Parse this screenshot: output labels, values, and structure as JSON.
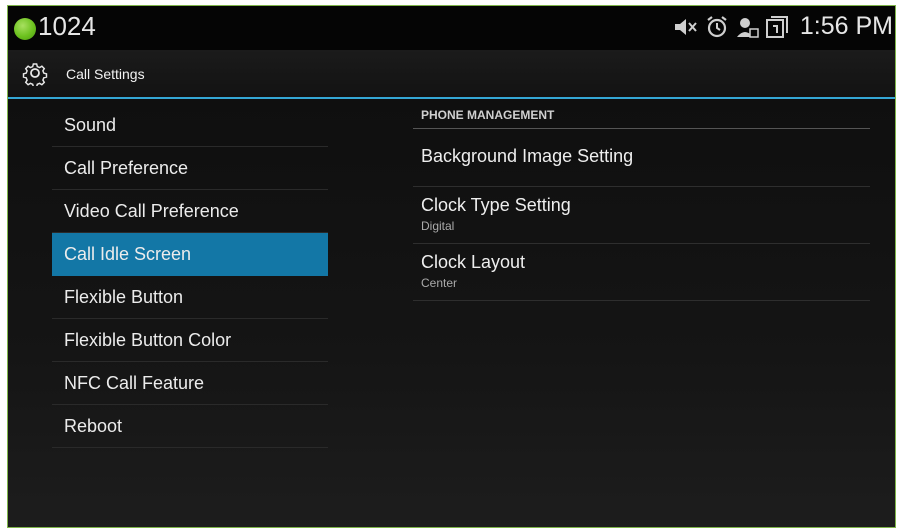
{
  "statusbar": {
    "extension": "1024",
    "time": "1:56 PM",
    "icons": [
      "speaker-muted-icon",
      "alarm-icon",
      "account-icon",
      "screen-icon"
    ],
    "colors": {
      "presence": "#6cc11e"
    }
  },
  "titlebar": {
    "icon": "gear-icon",
    "title": "Call Settings",
    "colors": {
      "divider": "#34a6d4"
    }
  },
  "menu": {
    "selected_index": 3,
    "colors": {
      "selected": "#1377a6"
    },
    "items": [
      {
        "label": "Sound"
      },
      {
        "label": "Call Preference"
      },
      {
        "label": "Video Call Preference"
      },
      {
        "label": "Call Idle Screen"
      },
      {
        "label": "Flexible Button"
      },
      {
        "label": "Flexible Button Color"
      },
      {
        "label": "NFC Call Feature"
      },
      {
        "label": "Reboot"
      }
    ]
  },
  "panel": {
    "section_header": "PHONE MANAGEMENT",
    "items": [
      {
        "title": "Background Image Setting",
        "summary": ""
      },
      {
        "title": "Clock Type Setting",
        "summary": "Digital"
      },
      {
        "title": "Clock Layout",
        "summary": "Center"
      }
    ]
  }
}
